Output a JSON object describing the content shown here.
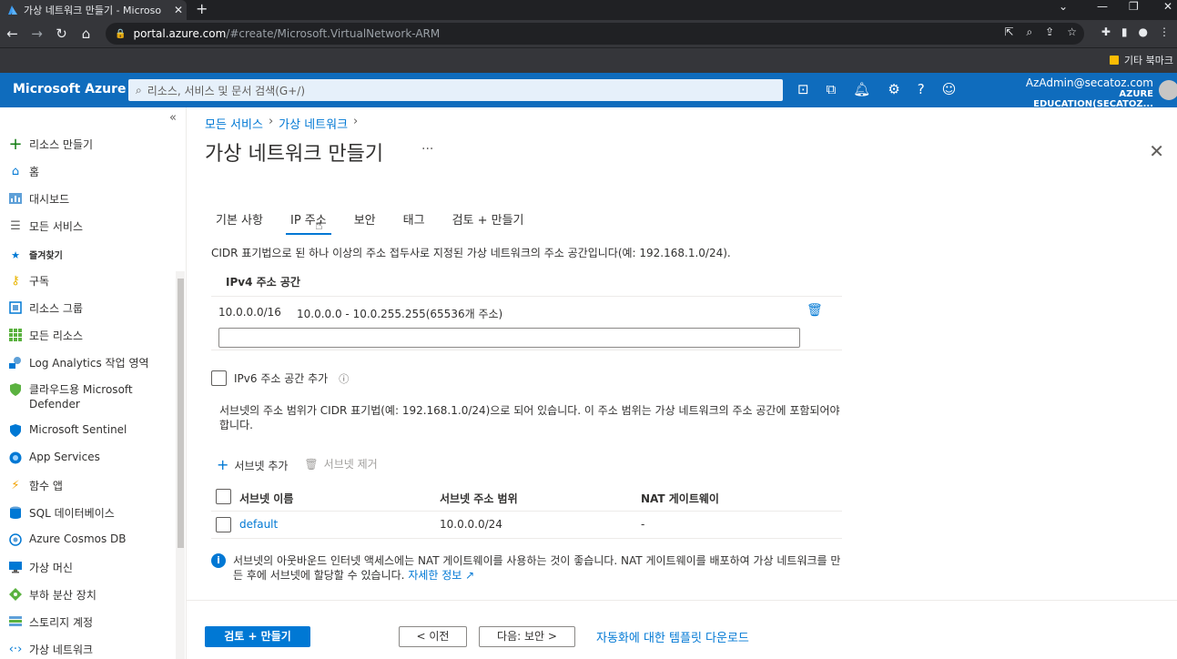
{
  "browser": {
    "tab_title": "가상 네트워크 만들기 - Microso",
    "url_host": "portal.azure.com",
    "url_path": "/#create/Microsoft.VirtualNetwork-ARM",
    "bookmarks_label": "기타 북마크"
  },
  "azure": {
    "brand": "Microsoft Azure",
    "search_placeholder": "리소스, 서비스 및 문서 검색(G+/)",
    "user_email": "AzAdmin@secatoz.com",
    "user_tenant": "AZURE EDUCATION(SECATOZ...",
    "accent": "#0f6cbd"
  },
  "sidebar": {
    "items": [
      {
        "label": "리소스 만들기",
        "icon": "plus-icon"
      },
      {
        "label": "홈",
        "icon": "home-icon"
      },
      {
        "label": "대시보드",
        "icon": "dashboard-icon"
      },
      {
        "label": "모든 서비스",
        "icon": "list-icon"
      },
      {
        "label": "즐겨찾기",
        "icon": "star-icon"
      },
      {
        "label": "구독",
        "icon": "key-icon"
      },
      {
        "label": "리소스 그룹",
        "icon": "resource-group-icon"
      },
      {
        "label": "모든 리소스",
        "icon": "grid-icon"
      },
      {
        "label": "Log Analytics 작업 영역",
        "icon": "log-analytics-icon"
      },
      {
        "label": "클라우드용 Microsoft",
        "label2": "Defender",
        "icon": "defender-icon"
      },
      {
        "label": "Microsoft Sentinel",
        "icon": "sentinel-icon"
      },
      {
        "label": "App Services",
        "icon": "app-services-icon"
      },
      {
        "label": "함수 앱",
        "icon": "function-icon"
      },
      {
        "label": "SQL 데이터베이스",
        "icon": "sql-icon"
      },
      {
        "label": "Azure Cosmos DB",
        "icon": "cosmos-icon"
      },
      {
        "label": "가상 머신",
        "icon": "vm-icon"
      },
      {
        "label": "부하 분산 장치",
        "icon": "load-balancer-icon"
      },
      {
        "label": "스토리지 계정",
        "icon": "storage-icon"
      },
      {
        "label": "가상 네트워크",
        "icon": "vnet-icon"
      }
    ]
  },
  "breadcrumb": [
    "모든 서비스",
    "가상 네트워크"
  ],
  "page_title": "가상 네트워크 만들기",
  "tabs": [
    "기본 사항",
    "IP 주소",
    "보안",
    "태그",
    "검토 + 만들기"
  ],
  "active_tab": "IP 주소",
  "description": "CIDR 표기법으로 된 하나 이상의 주소 접두사로 지정된 가상 네트워크의 주소 공간입니다(예: 192.168.1.0/24).",
  "ipv4": {
    "header": "IPv4 주소 공간",
    "cidr": "10.0.0.0/16",
    "range": "10.0.0.0 - 10.0.255.255(65536개 주소)",
    "input_value": ""
  },
  "ipv6_label": "IPv6 주소 공간 추가",
  "subnet_note": "서브넷의 주소 범위가 CIDR 표기법(예: 192.168.1.0/24)으로 되어 있습니다. 이 주소 범위는 가상 네트워크의 주소 공간에 포함되어야 합니다.",
  "subnet_actions": {
    "add": "서브넷 추가",
    "remove": "서브넷 제거"
  },
  "subnet_table": {
    "headers": [
      "서브넷 이름",
      "서브넷 주소 범위",
      "NAT 게이트웨이"
    ],
    "rows": [
      {
        "name": "default",
        "range": "10.0.0.0/24",
        "nat": "-"
      }
    ]
  },
  "info": {
    "text": "서브넷의 아웃바운드 인터넷 액세스에는 NAT 게이트웨이를 사용하는 것이 좋습니다. NAT 게이트웨이를 배포하여 가상 네트워크를 만든 후에 서브넷에 할당할 수 있습니다.",
    "link": "자세한 정보"
  },
  "footer": {
    "review_create": "검토 + 만들기",
    "prev": "< 이전",
    "next": "다음: 보안 >",
    "template_link": "자동화에 대한 템플릿 다운로드"
  }
}
